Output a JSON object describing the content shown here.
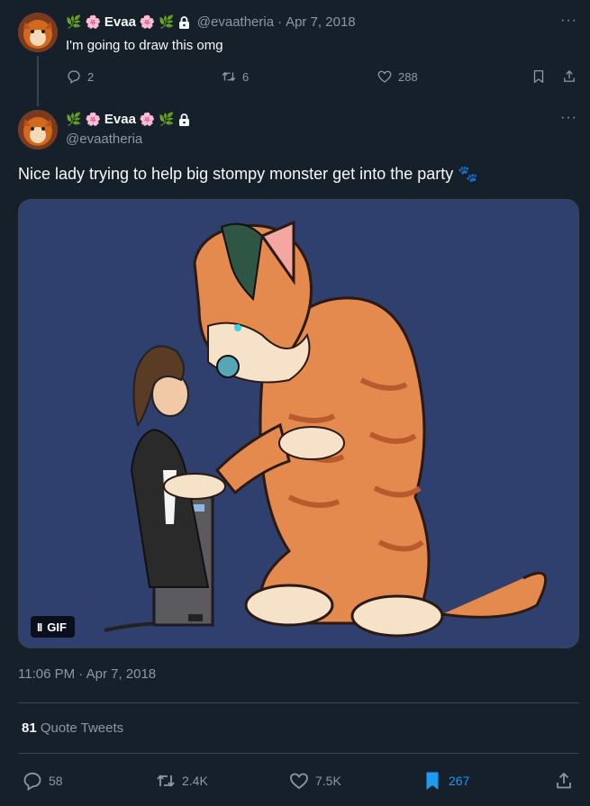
{
  "reply_tweet": {
    "display_name": "Evaa",
    "handle": "@evaatheria",
    "separator": "·",
    "date": "Apr 7, 2018",
    "text": "I'm going to draw this omg",
    "more_label": "···",
    "actions": {
      "replies": "2",
      "retweets": "6",
      "likes": "288"
    }
  },
  "main_tweet": {
    "display_name": "Evaa",
    "handle": "@evaatheria",
    "more_label": "···",
    "text": "Nice lady trying to help big stompy monster get into the party 🐾",
    "media": {
      "gif_label": "GIF",
      "pause_label": "II"
    },
    "timestamp": "11:06 PM · Apr 7, 2018",
    "quote_count": "81",
    "quote_label": "Quote Tweets",
    "actions": {
      "replies": "58",
      "retweets": "2.4K",
      "likes": "7.5K",
      "bookmarks": "267"
    }
  },
  "colors": {
    "background": "#15202b",
    "muted": "#8b98a5",
    "bookmark_active": "#1d9bf0",
    "media_bg": "#2f3f6e"
  }
}
